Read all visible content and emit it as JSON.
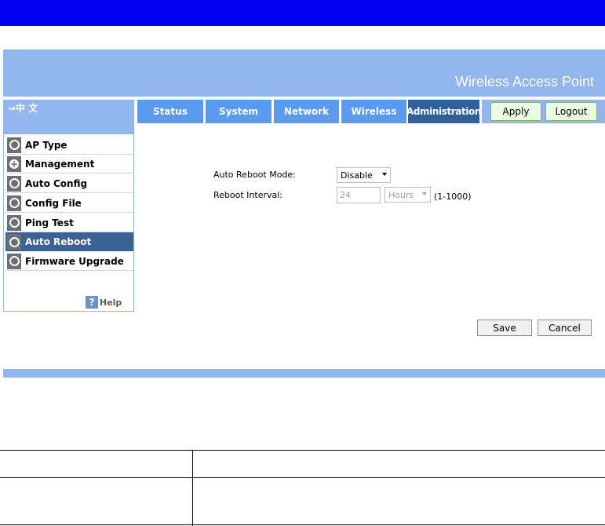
{
  "header": {
    "title": "Wireless Access Point"
  },
  "language": {
    "label": "⇒中 文"
  },
  "nav": {
    "tabs": [
      {
        "label": "Status"
      },
      {
        "label": "System"
      },
      {
        "label": "Network"
      },
      {
        "label": "Wireless"
      },
      {
        "label": "Administration",
        "active": true
      }
    ],
    "apply_label": "Apply",
    "logout_label": "Logout"
  },
  "sidebar": {
    "items": [
      {
        "label": "AP Type",
        "icon": "ring-icon"
      },
      {
        "label": "Management",
        "icon": "plus-icon"
      },
      {
        "label": "Auto Config",
        "icon": "ring-icon"
      },
      {
        "label": "Config File",
        "icon": "ring-icon"
      },
      {
        "label": "Ping Test",
        "icon": "ring-icon"
      },
      {
        "label": "Auto Reboot",
        "icon": "ring-icon",
        "active": true
      },
      {
        "label": "Firmware Upgrade",
        "icon": "ring-icon"
      }
    ],
    "help_icon": "?",
    "help_label": "Help"
  },
  "form": {
    "mode_label": "Auto Reboot Mode:",
    "mode_value": "Disable",
    "interval_label": "Reboot Interval:",
    "interval_value": "24",
    "interval_unit": "Hours",
    "interval_range": "(1-1000)",
    "save_label": "Save",
    "cancel_label": "Cancel"
  },
  "colors": {
    "top_bar": "#0000f4",
    "banner": "#92b5ee",
    "tab": "#5a9bf1",
    "tab_active": "#2f5f9c",
    "sidebar_active": "#3b6294"
  }
}
